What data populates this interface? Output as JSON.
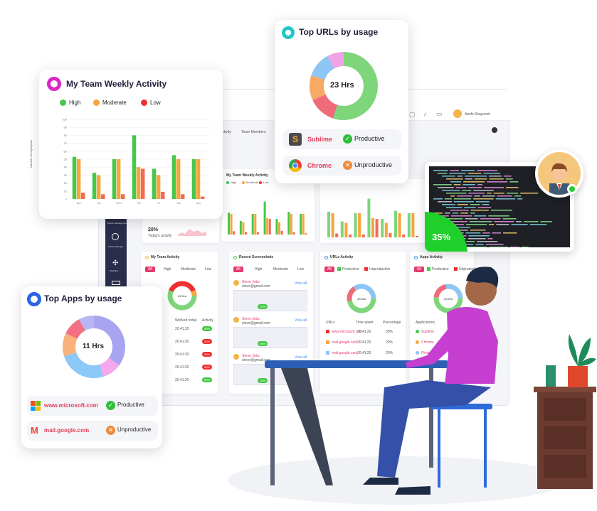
{
  "dashboard": {
    "user_name": "Anshi Shayeesh",
    "tabs": [
      "Activity",
      "Team Members"
    ],
    "weekly_title": "My Team Weekly Activity",
    "today_percent": "20%",
    "today_label": "Today's activity",
    "sidebar_items": [
      "Device Management",
      "Profile Manager",
      "Workflow"
    ],
    "panels": {
      "team_activity": "My Team Activity",
      "recent_screenshots": "Recent Screenshots",
      "urls_activity": "URLs Activity",
      "apps_activity": "Apps Activity"
    },
    "filter_all": "All",
    "filter_labels": [
      "High",
      "Moderate",
      "Low"
    ],
    "productive_label": "Productive",
    "unproductive_label": "Unproductive",
    "donut_center_small": "42 Hrs",
    "donut_urls_center": "23 Hrs",
    "donut_apps_center": "23 Hrs",
    "time_values": [
      "20:41:20",
      "20:41:20",
      "20:41:20",
      "20:41:20",
      "20:41:20"
    ],
    "pct_values": [
      "90%",
      "20%",
      "20%",
      "40%",
      "50%"
    ],
    "col_worked_today": "Worked today",
    "col_activity": "Activity",
    "col_urls": "URLs",
    "col_time_spent": "Time spent",
    "col_percentage": "Percentage",
    "col_applications": "Applications",
    "url_rows": [
      {
        "name": "www.microsoft.com",
        "time": "20:41:20",
        "pct": "50%"
      },
      {
        "name": "mail.google.com",
        "time": "20:41:20",
        "pct": "20%"
      },
      {
        "name": "mail.google.com",
        "time": "20:41:20",
        "pct": "20%"
      }
    ],
    "app_rows": [
      {
        "name": "Sublime",
        "time": "20:41:20",
        "pct": "50%"
      },
      {
        "name": "Chrome",
        "time": "20:41:20",
        "pct": "20%"
      },
      {
        "name": "Photoshop",
        "time": "20:41:20",
        "pct": "20%"
      }
    ],
    "screenshot_user": "Steve Jobs",
    "screenshot_email": "steve@gmail.com",
    "view_all": "View all",
    "screenshot_badges": [
      "70%",
      "40%",
      "70%",
      "40%",
      "70%"
    ]
  },
  "team_weekly": {
    "title": "My Team Weekly Activity",
    "legend": [
      {
        "label": "High",
        "color": "#46c84a"
      },
      {
        "label": "Moderate",
        "color": "#f7a53d"
      },
      {
        "label": "Low",
        "color": "#f0302e"
      }
    ],
    "ylabel": "Number of employees"
  },
  "chart_data": {
    "type": "bar",
    "categories": [
      "Mon",
      "Tue",
      "Wed",
      "Thu",
      "Fri",
      "Sat",
      "Sun"
    ],
    "series": [
      {
        "name": "High",
        "values": [
          53,
          33,
          50,
          80,
          38,
          55,
          50
        ]
      },
      {
        "name": "Moderate",
        "values": [
          50,
          30,
          50,
          40,
          30,
          50,
          50
        ]
      },
      {
        "name": "Low",
        "values": [
          8,
          6,
          6,
          38,
          9,
          6,
          3
        ]
      }
    ],
    "ylabel": "Number of employees",
    "ylim": [
      0,
      100
    ],
    "yticks": [
      0,
      10,
      20,
      30,
      40,
      50,
      60,
      70,
      80,
      90,
      100
    ],
    "colors": [
      "#46c84a",
      "#f7a53d",
      "#f56a55"
    ],
    "grid": true,
    "legend": "top"
  },
  "top_urls": {
    "title": "Top URLs by usage",
    "center_label": "23 Hrs",
    "segments": [
      {
        "value": 55,
        "color": "#7ed57a"
      },
      {
        "value": 13,
        "color": "#f06b7a"
      },
      {
        "value": 12,
        "color": "#f7a966"
      },
      {
        "value": 12,
        "color": "#8dc6f5"
      },
      {
        "value": 8,
        "color": "#f0a2e6"
      }
    ],
    "rows": [
      {
        "app": "Sublime",
        "status": "Productive",
        "icon": "sublime-icon",
        "status_icon": "check-circle-icon"
      },
      {
        "app": "Chrome",
        "status": "Unproductive",
        "icon": "chrome-icon",
        "status_icon": "x-circle-icon"
      }
    ]
  },
  "top_apps": {
    "title": "Top Apps by usage",
    "center_label": "11 Hrs",
    "segments": [
      {
        "value": 35,
        "color": "#a8a4f0"
      },
      {
        "value": 10,
        "color": "#f4a7ec"
      },
      {
        "value": 25,
        "color": "#8cc8f8"
      },
      {
        "value": 12,
        "color": "#f8b27a"
      },
      {
        "value": 10,
        "color": "#f36f82"
      },
      {
        "value": 8,
        "color": "#b9b5f5"
      }
    ],
    "rows": [
      {
        "app": "www.microsoft.com",
        "status": "Productive",
        "icon": "windows-icon",
        "status_icon": "check-circle-icon"
      },
      {
        "app": "mail.google.com",
        "status": "Unproductive",
        "icon": "gmail-icon",
        "status_icon": "x-circle-icon"
      }
    ]
  },
  "productivity_badge": "35%"
}
